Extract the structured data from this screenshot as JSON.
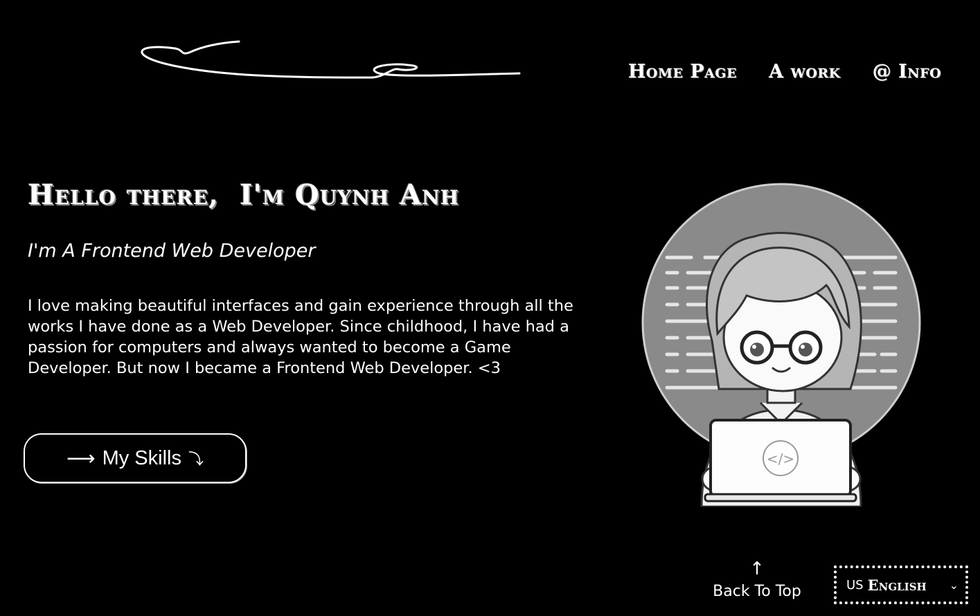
{
  "nav": {
    "items": [
      "Home Page",
      "A work",
      "@ Info"
    ]
  },
  "hero": {
    "title": "Hello there,  I'm Quynh Anh",
    "subtitle": "I'm A Frontend Web Developer",
    "bio": "I love making beautiful interfaces and gain experience through all the works I have done as a Web Developer. Since childhood, I have had a passion for computers and always wanted to become a Game Developer. But now I became a Frontend Web Developer. <3",
    "skills_button": {
      "arrow": "⟶",
      "label": "My Skills",
      "trail": "⤵"
    }
  },
  "footer": {
    "back_to_top_arrow": "↑",
    "back_to_top_label": "Back To Top",
    "language": {
      "flag": "US",
      "label": "English",
      "chevron": "⌄"
    }
  },
  "icons": {
    "logo": "signature-logo",
    "avatar": "developer-avatar-illustration",
    "laptop_badge": "code-icon"
  },
  "colors": {
    "background": "#000000",
    "text": "#ffffff"
  }
}
